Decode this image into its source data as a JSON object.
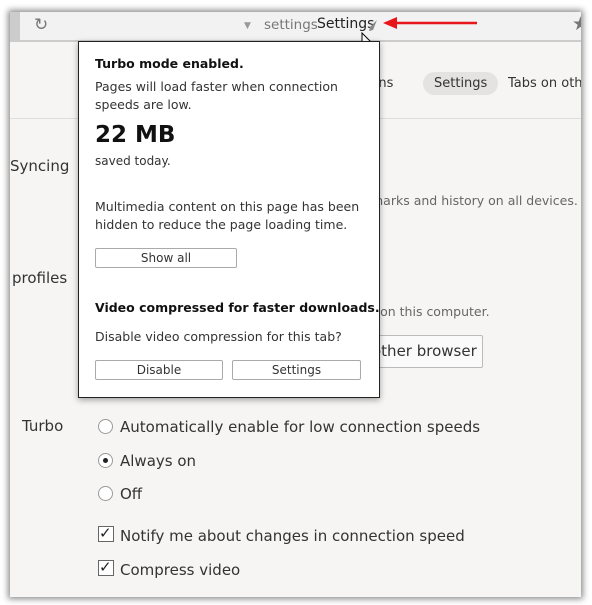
{
  "toolbar": {
    "reload_icon": "reload-icon",
    "dropdown_icon": "triangle-down-icon",
    "url_domain": "settings",
    "url_title": "Settings",
    "turbo_icon": "rocket-icon",
    "bookmark_icon": "star-icon"
  },
  "tabs": [
    {
      "label": "sions"
    },
    {
      "label": "Settings",
      "active": true
    },
    {
      "label": "Tabs on othe"
    }
  ],
  "sections": {
    "syncing": "Syncing",
    "syncing_text": "marks and history on all devices.",
    "profiles": "profiles",
    "profiles_text": "r on this computer.",
    "import_button": "other browser",
    "turbo": "Turbo"
  },
  "turbo_options": [
    {
      "label": "Automatically enable for low connection speeds",
      "selected": false
    },
    {
      "label": "Always on",
      "selected": true
    },
    {
      "label": "Off",
      "selected": false
    }
  ],
  "checkboxes": [
    {
      "label": "Notify me about changes in connection speed",
      "checked": true
    },
    {
      "label": "Compress video",
      "checked": true
    }
  ],
  "popup": {
    "title": "Turbo mode enabled.",
    "desc": "Pages will load faster when connection speeds are low.",
    "saved_amount": "22 MB",
    "saved_label": "saved today.",
    "multimedia_text": "Multimedia content on this page has been hidden to reduce the page loading time.",
    "show_all": "Show all",
    "video_title": "Video compressed for faster downloads.",
    "video_question": "Disable video compression for this tab?",
    "disable": "Disable",
    "settings": "Settings"
  },
  "colors": {
    "arrow": "#e8151b"
  }
}
